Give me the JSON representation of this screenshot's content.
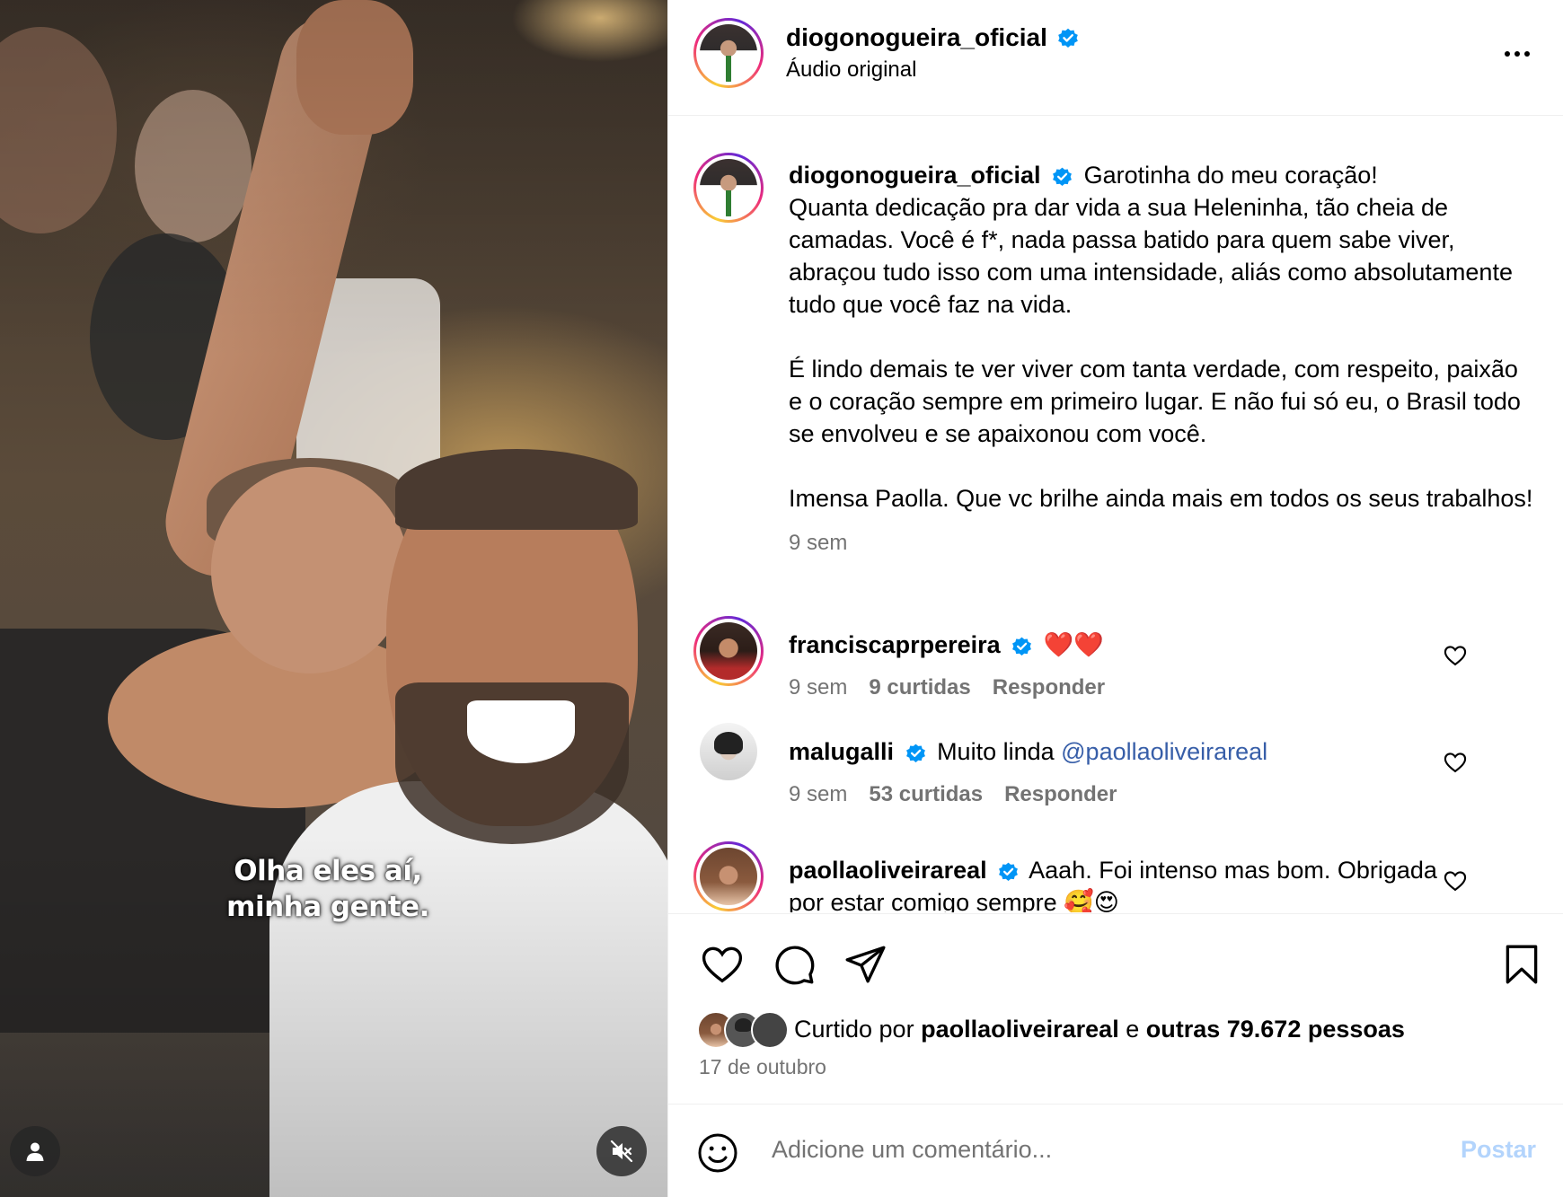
{
  "media": {
    "caption_line1": "Olha eles aí,",
    "caption_line2": "minha gente.",
    "user_icon": "user-icon",
    "mute_icon": "muted-speaker-icon"
  },
  "header": {
    "username": "diogonogueira_oficial",
    "subtitle": "Áudio original",
    "more_icon": "more-options-icon"
  },
  "post_caption": {
    "username": "diogonogueira_oficial",
    "first_line": "Garotinha do meu coração!",
    "paragraph1": "Quanta dedicação pra dar vida a sua Heleninha, tão cheia de camadas. Você é f*, nada passa batido para quem sabe viver, abraçou tudo isso com uma intensidade, aliás como absolutamente tudo que você faz na vida.",
    "paragraph2": "É lindo demais te ver viver com tanta verdade, com respeito, paixão e o coração sempre em primeiro lugar. E não fui só eu, o Brasil todo se envolveu e se apaixonou com você.",
    "paragraph3": "Imensa Paolla. Que vc brilhe ainda mais em todos os seus trabalhos!",
    "time": "9 sem"
  },
  "comments": [
    {
      "username": "franciscaprpereira",
      "text": "❤️❤️",
      "mention": "",
      "time": "9 sem",
      "likes": "9 curtidas",
      "reply": "Responder"
    },
    {
      "username": "malugalli",
      "text": "Muito linda ",
      "mention": "@paollaoliveirareal",
      "time": "9 sem",
      "likes": "53 curtidas",
      "reply": "Responder"
    },
    {
      "username": "paollaoliveirareal",
      "text": "Aaah. Foi intenso mas bom. Obrigada",
      "line2": "por estar comigo sempre 🥰😍",
      "mention": "",
      "time": "",
      "likes": "",
      "reply": ""
    }
  ],
  "actions": {
    "liked_prefix": "Curtido por ",
    "liked_user": "paollaoliveirareal",
    "liked_mid": " e ",
    "liked_others": "outras 79.672 pessoas",
    "date": "17 de outubro"
  },
  "composer": {
    "placeholder": "Adicione um comentário...",
    "post_label": "Postar"
  },
  "colors": {
    "verified": "#0095f6",
    "link": "#375ea8",
    "post_disabled": "#b3d4fc",
    "muted": "#737373"
  }
}
